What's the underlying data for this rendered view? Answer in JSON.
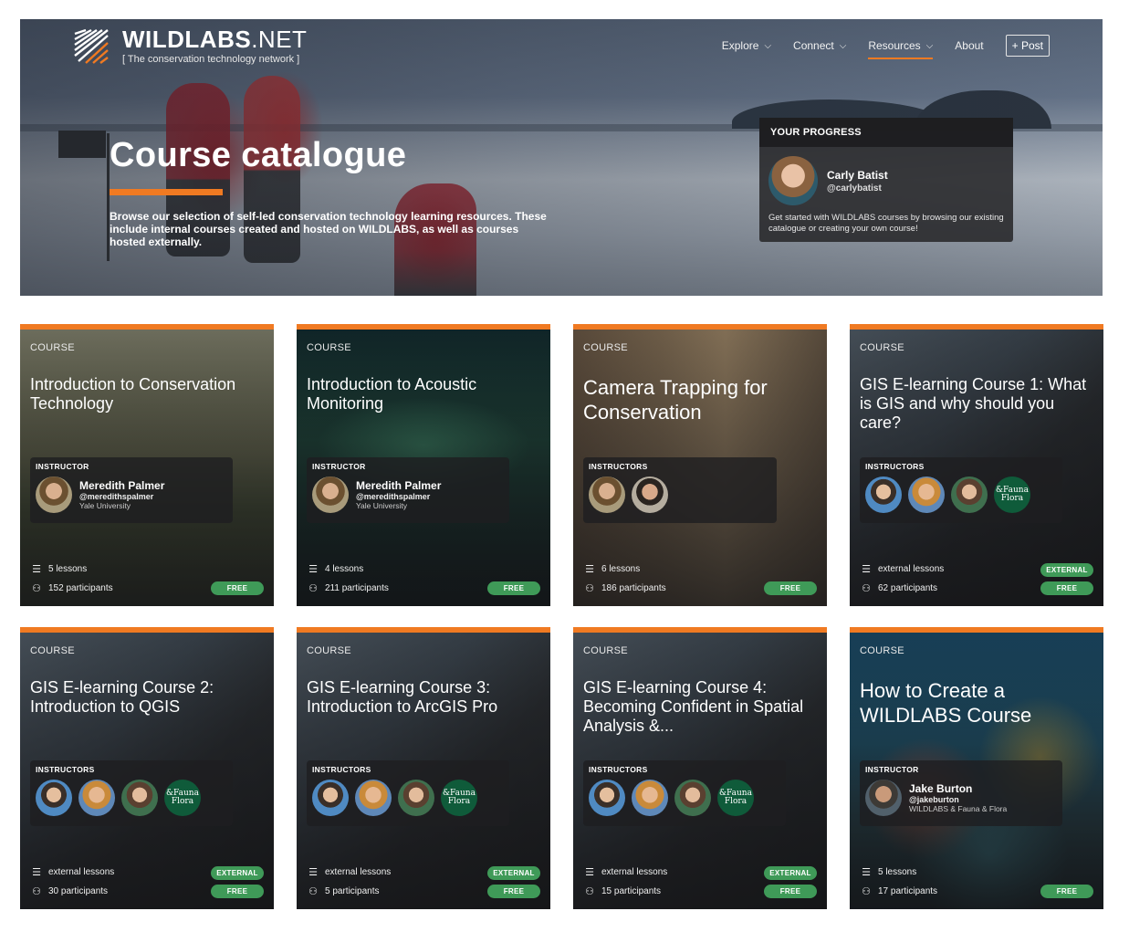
{
  "brand": {
    "name_bold": "WILDLABS",
    "name_light": ".NET",
    "tagline": "[ The conservation technology network ]"
  },
  "nav": {
    "items": [
      {
        "label": "Explore",
        "has_dropdown": true
      },
      {
        "label": "Connect",
        "has_dropdown": true
      },
      {
        "label": "Resources",
        "has_dropdown": true,
        "active": true
      },
      {
        "label": "About",
        "has_dropdown": false
      }
    ],
    "post_label": "+ Post"
  },
  "hero": {
    "title": "Course catalogue",
    "description": "Browse our selection of self-led conservation technology learning resources. These include internal courses created and hosted on WILDLABS, as well as courses hosted externally."
  },
  "progress": {
    "heading": "YOUR PROGRESS",
    "user_name": "Carly Batist",
    "user_handle": "@carlybatist",
    "description": "Get started with WILDLABS courses by browsing our existing catalogue or creating your own course!"
  },
  "colors": {
    "accent": "#f07a22",
    "badge": "#3f9a58",
    "ffi_logo": "#0f5b3a"
  },
  "labels": {
    "ffi_logo": "&Fauna Flora"
  },
  "courses": [
    {
      "kind": "COURSE",
      "title": "Introduction to Conservation Technology",
      "instructor_label": "INSTRUCTOR",
      "instructor_name": "Meredith Palmer",
      "instructor_handle": "@meredithspalmer",
      "instructor_org": "Yale University",
      "lessons": "5 lessons",
      "participants": "152 participants",
      "free": "FREE"
    },
    {
      "kind": "COURSE",
      "title": "Introduction to Acoustic Monitoring",
      "instructor_label": "INSTRUCTOR",
      "instructor_name": "Meredith Palmer",
      "instructor_handle": "@meredithspalmer",
      "instructor_org": "Yale University",
      "lessons": "4 lessons",
      "participants": "211 participants",
      "free": "FREE"
    },
    {
      "kind": "COURSE",
      "title": "Camera Trapping for Conservation",
      "instructor_label": "INSTRUCTORS",
      "lessons": "6 lessons",
      "participants": "186 participants",
      "free": "FREE"
    },
    {
      "kind": "COURSE",
      "title": "GIS E-learning Course 1: What is GIS and why should you care?",
      "instructor_label": "INSTRUCTORS",
      "lessons": "external lessons",
      "participants": "62 participants",
      "external": "EXTERNAL",
      "free": "FREE"
    },
    {
      "kind": "COURSE",
      "title": "GIS E-learning Course 2: Introduction to QGIS",
      "instructor_label": "INSTRUCTORS",
      "lessons": "external lessons",
      "participants": "30 participants",
      "external": "EXTERNAL",
      "free": "FREE"
    },
    {
      "kind": "COURSE",
      "title": "GIS E-learning Course 3: Introduction to ArcGIS Pro",
      "instructor_label": "INSTRUCTORS",
      "lessons": "external lessons",
      "participants": "5 participants",
      "external": "EXTERNAL",
      "free": "FREE"
    },
    {
      "kind": "COURSE",
      "title": "GIS E-learning Course 4: Becoming Confident in Spatial Analysis &...",
      "instructor_label": "INSTRUCTORS",
      "lessons": "external lessons",
      "participants": "15 participants",
      "external": "EXTERNAL",
      "free": "FREE"
    },
    {
      "kind": "COURSE",
      "title": "How to Create a WILDLABS Course",
      "instructor_label": "INSTRUCTOR",
      "instructor_name": "Jake Burton",
      "instructor_handle": "@jakeburton",
      "instructor_org": "WILDLABS & Fauna & Flora",
      "lessons": "5 lessons",
      "participants": "17 participants",
      "free": "FREE"
    }
  ]
}
